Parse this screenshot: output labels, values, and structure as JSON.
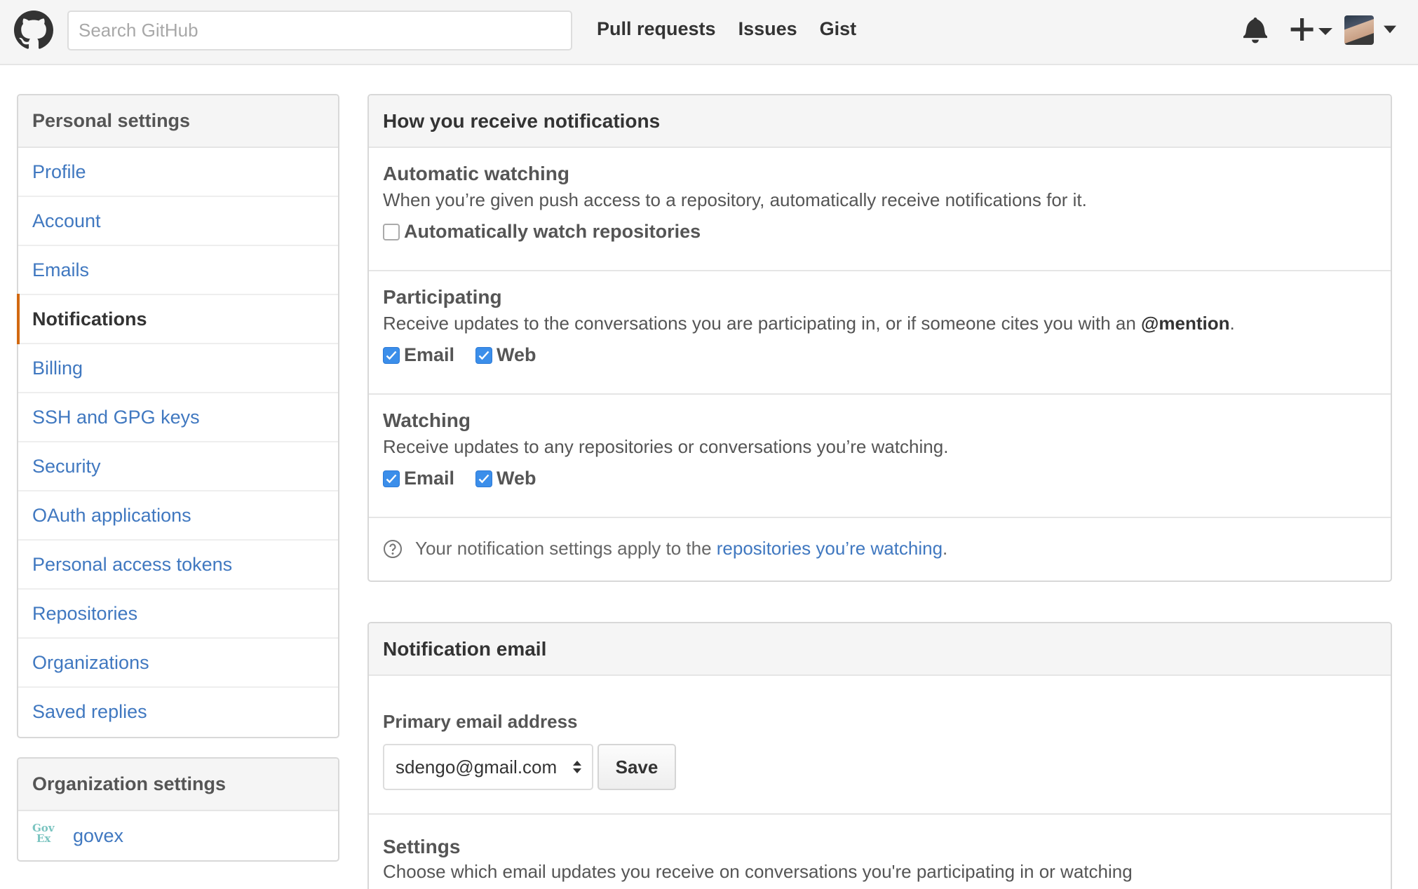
{
  "header": {
    "search_placeholder": "Search GitHub",
    "nav": [
      "Pull requests",
      "Issues",
      "Gist"
    ]
  },
  "sidebar": {
    "personal_heading": "Personal settings",
    "items": [
      {
        "label": "Profile",
        "selected": false
      },
      {
        "label": "Account",
        "selected": false
      },
      {
        "label": "Emails",
        "selected": false
      },
      {
        "label": "Notifications",
        "selected": true
      },
      {
        "label": "Billing",
        "selected": false
      },
      {
        "label": "SSH and GPG keys",
        "selected": false
      },
      {
        "label": "Security",
        "selected": false
      },
      {
        "label": "OAuth applications",
        "selected": false
      },
      {
        "label": "Personal access tokens",
        "selected": false
      },
      {
        "label": "Repositories",
        "selected": false
      },
      {
        "label": "Organizations",
        "selected": false
      },
      {
        "label": "Saved replies",
        "selected": false
      }
    ],
    "org_heading": "Organization settings",
    "org": {
      "name": "govex",
      "logo_text_1": "Gov",
      "logo_text_2": "Ex"
    }
  },
  "receive": {
    "title": "How you receive notifications",
    "auto_watch": {
      "heading": "Automatic watching",
      "description": "When you’re given push access to a repository, automatically receive notifications for it.",
      "checkbox_label": "Automatically watch repositories",
      "checked": false
    },
    "participating": {
      "heading": "Participating",
      "description": "Receive updates to the conversations you are participating in, or if someone cites you with an ",
      "mention": "@mention",
      "suffix": ".",
      "email_label": "Email",
      "email_checked": true,
      "web_label": "Web",
      "web_checked": true
    },
    "watching": {
      "heading": "Watching",
      "description": "Receive updates to any repositories or conversations you’re watching.",
      "email_label": "Email",
      "email_checked": true,
      "web_label": "Web",
      "web_checked": true
    },
    "note": {
      "prefix": "Your notification settings apply to the ",
      "link": "repositories you’re watching",
      "suffix": "."
    }
  },
  "email_box": {
    "title": "Notification email",
    "primary_label": "Primary email address",
    "selected_email": "sdengo@gmail.com",
    "save_label": "Save",
    "settings_heading": "Settings",
    "settings_description": "Choose which email updates you receive on conversations you're participating in or watching"
  },
  "colors": {
    "link": "#4078c0",
    "selected_accent": "#d26911",
    "checkbox": "#3b8eea"
  }
}
